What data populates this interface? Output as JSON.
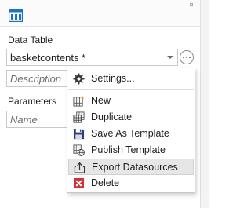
{
  "data_table": {
    "label": "Data Table",
    "selected_value": "basketcontents *"
  },
  "description_field": {
    "placeholder": "Description"
  },
  "parameters": {
    "label": "Parameters",
    "name_placeholder": "Name"
  },
  "context_menu": {
    "settings": "Settings...",
    "items": [
      "New",
      "Duplicate",
      "Save As Template",
      "Publish Template",
      "Export Datasources",
      "Delete"
    ]
  },
  "colors": {
    "logo_blue": "#1e73be",
    "delete_red": "#c8363d",
    "menu_hover": "#e6e6e6"
  },
  "icons": {
    "settings": "gear-icon",
    "new": "new-table-icon",
    "duplicate": "duplicate-table-icon",
    "save_as_template": "save-disk-icon",
    "publish_template": "publish-globe-icon",
    "export_datasources": "export-box-icon",
    "delete": "delete-x-icon"
  }
}
